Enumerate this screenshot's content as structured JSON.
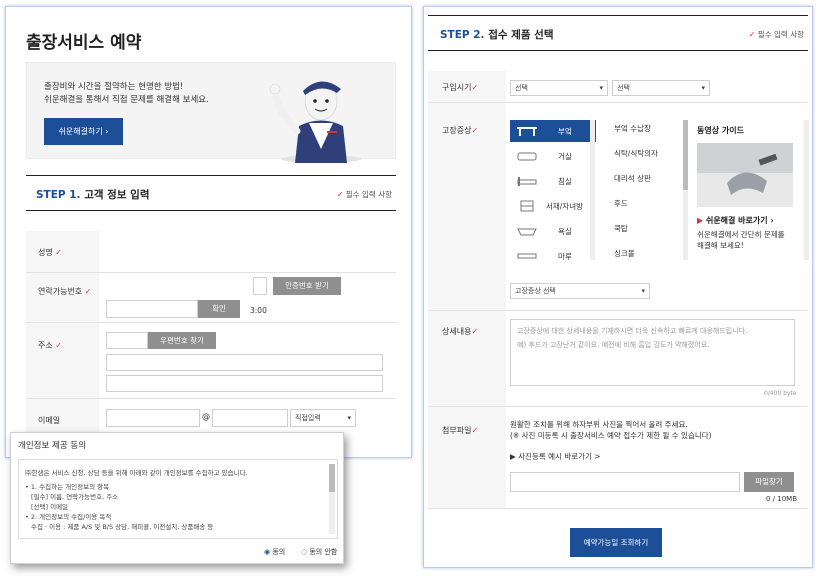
{
  "left": {
    "page_title": "출장서비스 예약",
    "banner": {
      "line1": "출장비와 시간을 절약하는 현명한 방법!",
      "line2": "쉬운해결을 통해서 직접 문제를 해결해 보세요.",
      "button": "쉬운해결하기  ›"
    },
    "step1": {
      "num": "STEP 1.",
      "title": "고객 정보 입력",
      "required": "필수 입력 사항"
    },
    "fields": {
      "name": "성명",
      "phone": "연락가능번호",
      "auth_button": "인증번호 받기",
      "confirm_button": "확인",
      "timer": "3:00",
      "address": "주소",
      "zip_button": "우편번호 찾기",
      "email": "이메일",
      "at": "@",
      "email_domain": "직접입력"
    }
  },
  "popup": {
    "title": "개인정보 제공 동의",
    "intro": "㈜한샘은 서비스 신청, 상담 등을 위해 아래와 같이 개인정보를 수집하고 있습니다.",
    "l1": "• 1. 수집하는 개인정보의 항목",
    "l2": "[필수] 이름, 연락가능번호, 주소",
    "l3": "[선택] 이메일",
    "l4": "• 2. 개인정보의 수집/이용 목적",
    "l5": "수집 · 이용 : 제품 A/S 및 B/S 상담, 해피콜, 이전설치, 상품배송 등",
    "agree": "동의",
    "disagree": "동의 안함"
  },
  "right": {
    "step2": {
      "num": "STEP 2.",
      "title": "접수 제품 선택",
      "required": "필수 입력 사항"
    },
    "purchase_label": "구입시기",
    "purchase_sel1": "선택",
    "purchase_sel2": "선택",
    "symptom_label": "고장증상",
    "categories": [
      "부엌",
      "거실",
      "침실",
      "서재/자녀방",
      "욕실",
      "마루"
    ],
    "subcategories": [
      "부엌 수납장",
      "식탁/식탁의자",
      "대리석 상판",
      "후드",
      "쿡탑",
      "싱크볼"
    ],
    "video_guide": "동영상 가이드",
    "easy_fix_link": "쉬운해결 바로가기",
    "easy_fix_desc1": "쉬운해결에서 간단히 문제를",
    "easy_fix_desc2": "해결해 보세요!",
    "symptom_select": "고장증상 선택",
    "detail_label": "상세내용",
    "detail_placeholder1": "고장증상에 대한 상세내용을 기재하시면 더욱 신속하고 빠르게 대응해드립니다.",
    "detail_placeholder2": "예) 후드가 고장난거 같아요. 예전에 비해 흡입 강도가 약해졌어요.",
    "byte_count": "0/400 byte",
    "attach_label": "첨부파일",
    "attach_desc1": "원활한 조치를 위해 하자부위 사진을 찍어서 올려 주세요.",
    "attach_desc2": "(※ 사진 미등록 시 출장서비스 예약 접수가 제한 될 수 있습니다)",
    "photo_example": "▶ 사진등록 예시 바로가기 >",
    "file_button": "파일찾기",
    "file_size": "0 / 10MB",
    "submit": "예약가능일 조회하기"
  },
  "colors": {
    "accent": "#1d4f99",
    "required_mark": "#d1343e",
    "gray_button": "#8f8f8f"
  }
}
